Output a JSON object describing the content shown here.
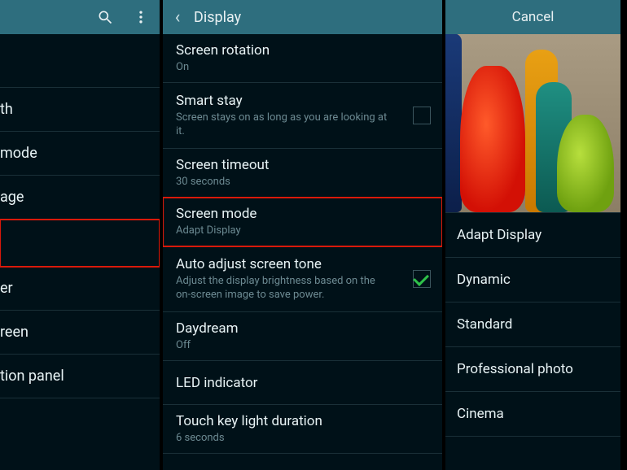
{
  "panel1": {
    "header_icons": {
      "search": "search",
      "more": "more"
    },
    "items": [
      {
        "label": "th"
      },
      {
        "label": "mode"
      },
      {
        "label": "age"
      },
      {
        "label": ""
      },
      {
        "label": "er"
      },
      {
        "label": "reen"
      },
      {
        "label": "tion panel"
      }
    ]
  },
  "panel2": {
    "title": "Display",
    "rows": [
      {
        "title": "Screen rotation",
        "sub": "On",
        "control": null
      },
      {
        "title": "Smart stay",
        "sub": "Screen stays on as long as you are looking at it.",
        "control": "checkbox-unchecked"
      },
      {
        "title": "Screen timeout",
        "sub": "30 seconds",
        "control": null
      },
      {
        "title": "Screen mode",
        "sub": "Adapt Display",
        "control": null,
        "highlighted": true
      },
      {
        "title": "Auto adjust screen tone",
        "sub": "Adjust the display brightness based on the on-screen image to save power.",
        "control": "checkbox-checked"
      },
      {
        "title": "Daydream",
        "sub": "Off",
        "control": null
      },
      {
        "title": "LED indicator",
        "sub": "",
        "control": null
      },
      {
        "title": "Touch key light duration",
        "sub": "6 seconds",
        "control": null
      }
    ]
  },
  "panel3": {
    "cancel": "Cancel",
    "modes": [
      "Adapt Display",
      "Dynamic",
      "Standard",
      "Professional photo",
      "Cinema"
    ]
  }
}
